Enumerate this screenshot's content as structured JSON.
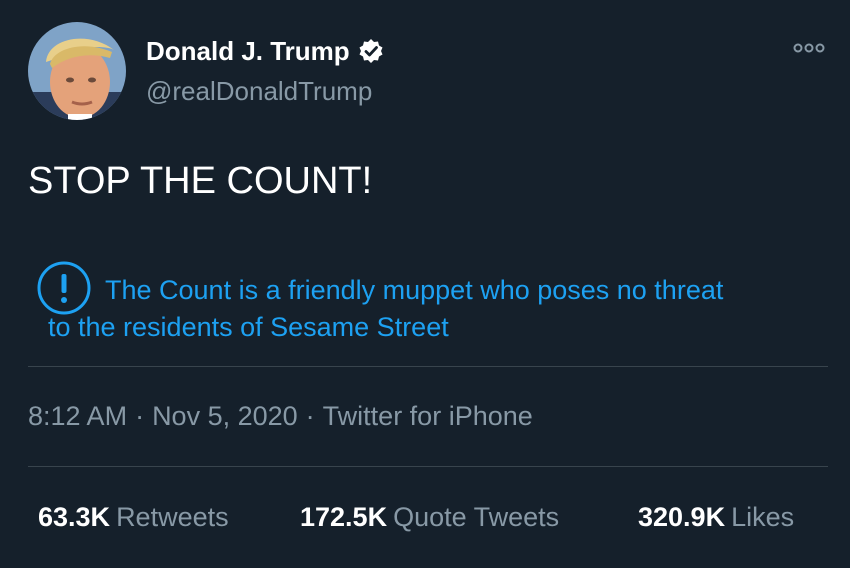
{
  "author": {
    "display_name": "Donald J. Trump",
    "handle": "@realDonaldTrump",
    "verified": true,
    "avatar_icon": "profile-photo"
  },
  "tweet": {
    "text": "STOP THE COUNT!"
  },
  "notice": {
    "icon": "exclamation-circle-icon",
    "line1": "The Count is a friendly muppet who poses no threat",
    "line2": "to the residents of Sesame Street"
  },
  "meta": {
    "time": "8:12 AM",
    "date": "Nov 5, 2020",
    "source": "Twitter for iPhone",
    "separator": "·"
  },
  "stats": {
    "retweets_count": "63.3K",
    "retweets_label": "Retweets",
    "quotes_count": "172.5K",
    "quotes_label": "Quote Tweets",
    "likes_count": "320.9K",
    "likes_label": "Likes"
  },
  "colors": {
    "background": "#15202b",
    "accent": "#1da1f2",
    "secondary_text": "#8899a6",
    "divider": "#38444d"
  }
}
